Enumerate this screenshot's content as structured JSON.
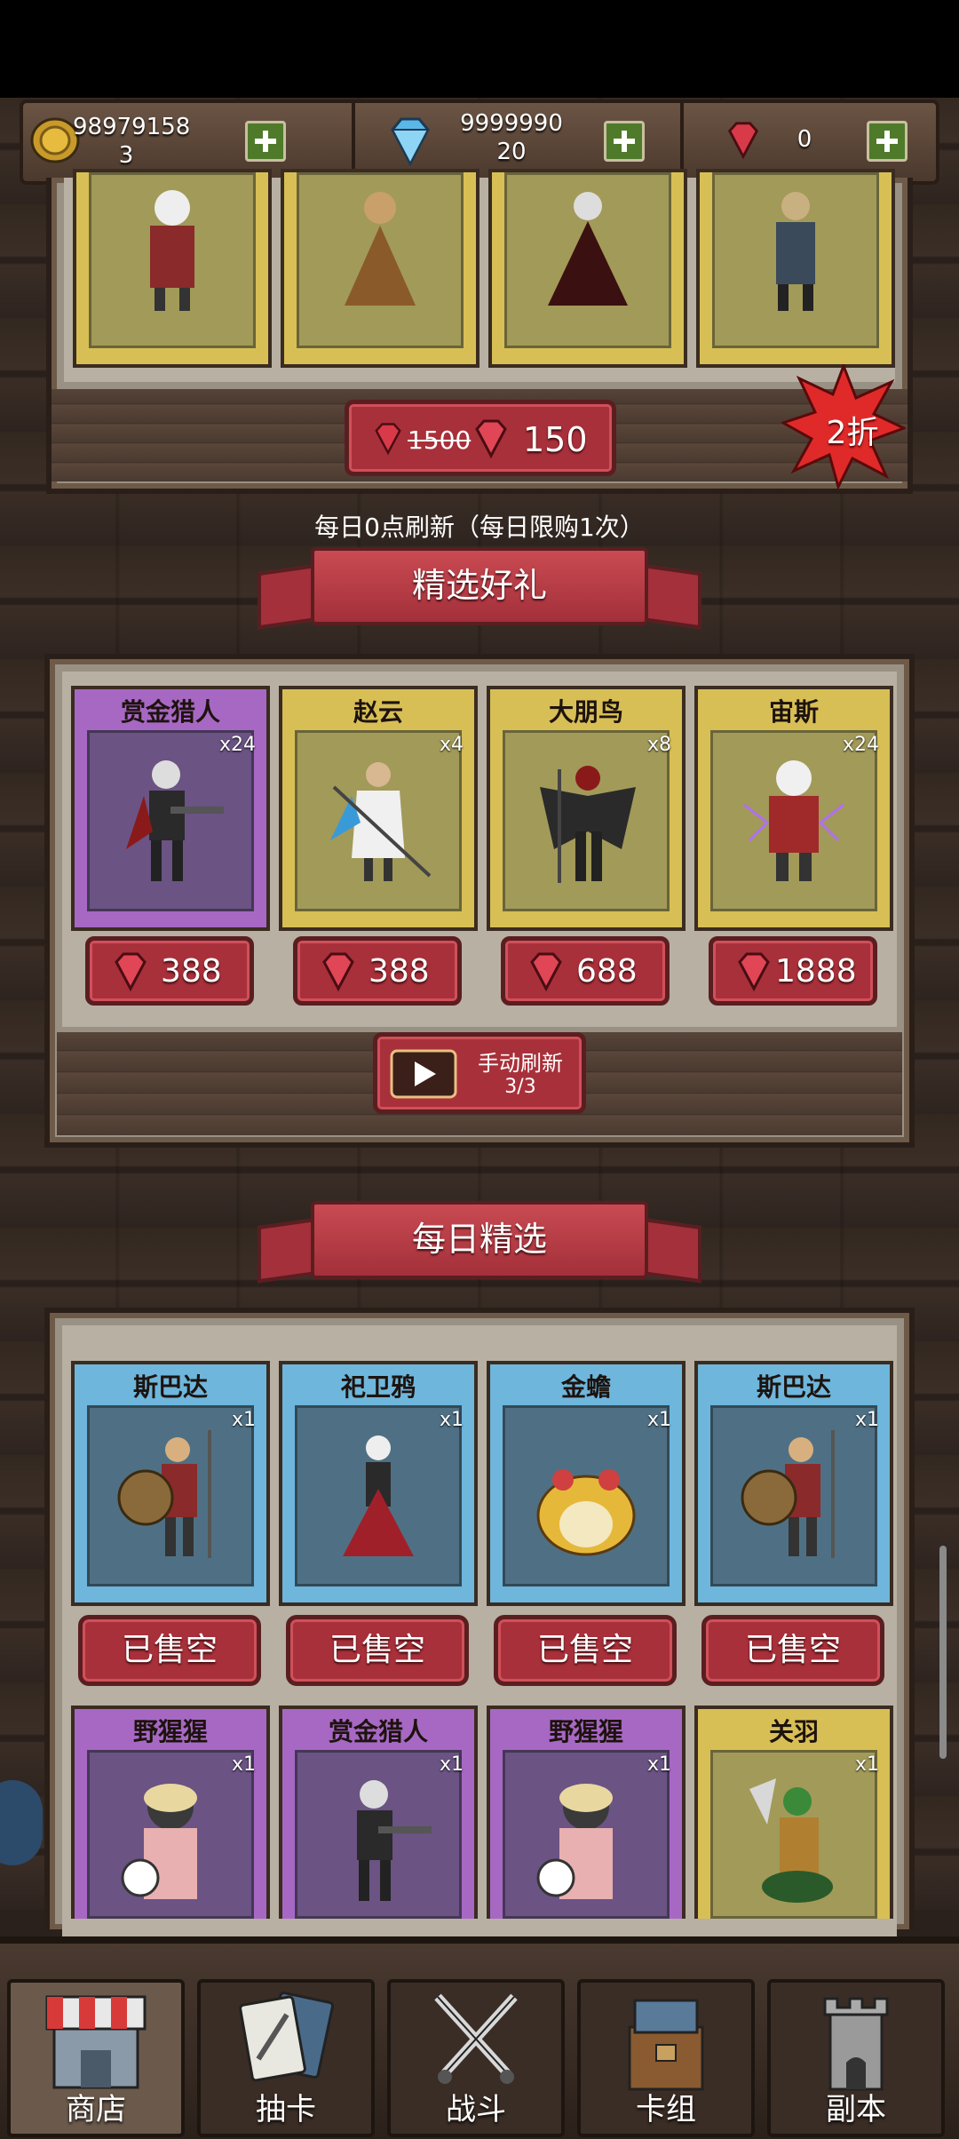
{
  "currency": {
    "gold_value": "98979158",
    "gold_sub": "3",
    "diamond_value": "9999990",
    "diamond_sub": "20",
    "ruby_value": "0"
  },
  "special_offer": {
    "old_price": "1500",
    "new_price": "150",
    "discount_badge": "2折",
    "refresh_note": "每日0点刷新（每日限购1次）"
  },
  "featured": {
    "title": "精选好礼",
    "cards": [
      {
        "name": "赏金猎人",
        "qty": "x24",
        "rarity": "purple",
        "price": "388"
      },
      {
        "name": "赵云",
        "qty": "x4",
        "rarity": "gold",
        "price": "388"
      },
      {
        "name": "大朋鸟",
        "qty": "x8",
        "rarity": "gold",
        "price": "688"
      },
      {
        "name": "宙斯",
        "qty": "x24",
        "rarity": "gold",
        "price": "1888"
      }
    ],
    "refresh_label": "手动刷新",
    "refresh_count": "3/3"
  },
  "daily": {
    "title": "每日精选",
    "row1": [
      {
        "name": "斯巴达",
        "qty": "x1",
        "rarity": "blue",
        "status": "已售空"
      },
      {
        "name": "祀卫鸦",
        "qty": "x1",
        "rarity": "blue",
        "status": "已售空"
      },
      {
        "name": "金蟾",
        "qty": "x1",
        "rarity": "blue",
        "status": "已售空"
      },
      {
        "name": "斯巴达",
        "qty": "x1",
        "rarity": "blue",
        "status": "已售空"
      }
    ],
    "row2": [
      {
        "name": "野猩猩",
        "qty": "x1",
        "rarity": "purple"
      },
      {
        "name": "赏金猎人",
        "qty": "x1",
        "rarity": "purple"
      },
      {
        "name": "野猩猩",
        "qty": "x1",
        "rarity": "purple"
      },
      {
        "name": "关羽",
        "qty": "x1",
        "rarity": "gold"
      }
    ]
  },
  "nav": [
    {
      "label": "商店",
      "icon": "shop-icon",
      "active": true
    },
    {
      "label": "抽卡",
      "icon": "draw-card-icon",
      "active": false
    },
    {
      "label": "战斗",
      "icon": "crossed-swords-icon",
      "active": false
    },
    {
      "label": "卡组",
      "icon": "card-deck-icon",
      "active": false
    },
    {
      "label": "副本",
      "icon": "tower-icon",
      "active": false
    }
  ],
  "colors": {
    "gold_card": "#d8bf55",
    "purple_card": "#a768c4",
    "blue_card": "#6eb6dc",
    "red_button": "#a8303a"
  }
}
